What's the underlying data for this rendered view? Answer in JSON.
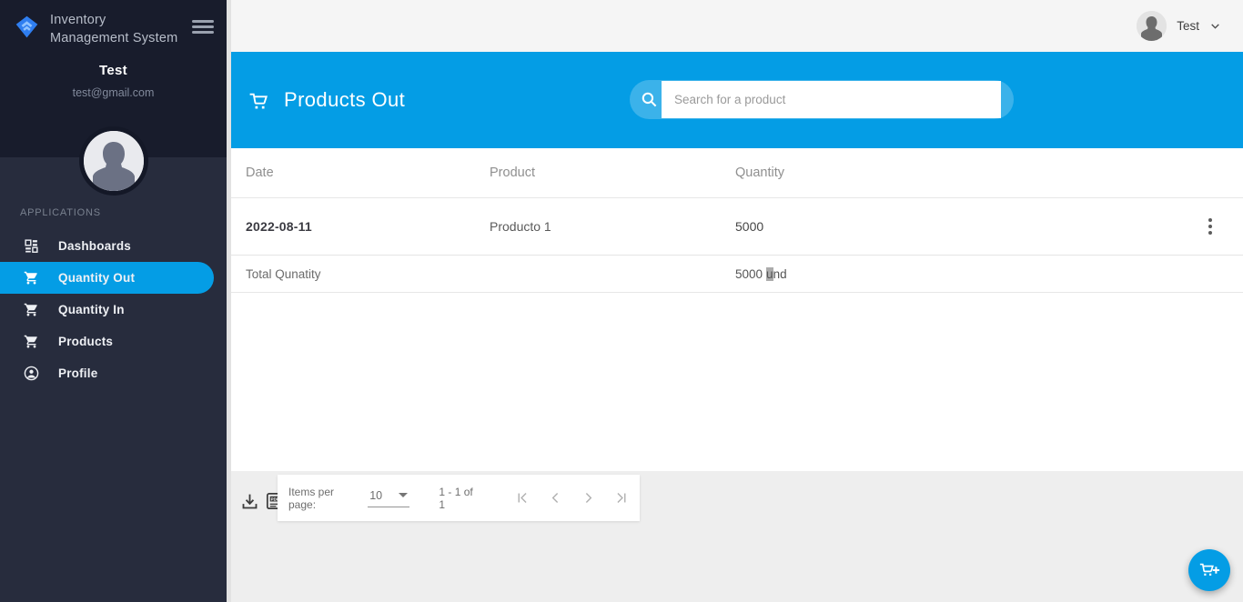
{
  "app": {
    "title": "Inventory Management System"
  },
  "sidebar": {
    "user_name": "Test",
    "user_email": "test@gmail.com",
    "section_label": "APPLICATIONS",
    "items": [
      {
        "label": "Dashboards",
        "icon": "dashboard-icon",
        "active": false
      },
      {
        "label": "Quantity Out",
        "icon": "cart-icon",
        "active": true
      },
      {
        "label": "Quantity In",
        "icon": "cart-icon",
        "active": false
      },
      {
        "label": "Products",
        "icon": "cart-icon",
        "active": false
      },
      {
        "label": "Profile",
        "icon": "profile-icon",
        "active": false
      }
    ]
  },
  "topbar": {
    "user_label": "Test"
  },
  "banner": {
    "title": "Products Out",
    "title_icon": "cart-icon",
    "search_placeholder": "Search for a product"
  },
  "table": {
    "columns": [
      "Date",
      "Product",
      "Quantity"
    ],
    "rows": [
      {
        "date": "2022-08-11",
        "product": "Producto 1",
        "quantity": "5000"
      }
    ],
    "total": {
      "label": "Total Qunatity",
      "amount": "5000",
      "unit_highlight": "u",
      "unit_rest": "nd"
    }
  },
  "pagination": {
    "items_per_page_label": "Items per page:",
    "items_per_page_value": "10",
    "range_label": "1 - 1 of 1"
  },
  "colors": {
    "accent_blue": "#049de5",
    "sidebar_top": "#181c2c",
    "sidebar_body": "#272c3d",
    "content_gray": "#eeeeee"
  }
}
